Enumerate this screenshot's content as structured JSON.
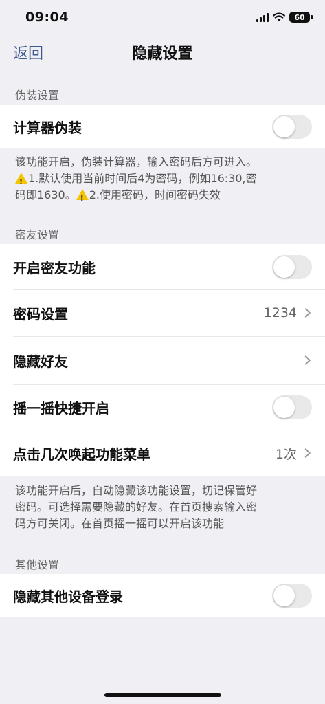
{
  "status_bar": {
    "time": "09:04",
    "battery": "60"
  },
  "nav": {
    "back_label": "返回",
    "title": "隐藏设置"
  },
  "sections": {
    "disguise": {
      "header": "伪装设置",
      "calculator_label": "计算器伪装",
      "calculator_toggle": false,
      "note_line1": "该功能开启，伪装计算器，输入密码后方可进入。",
      "note_part1": "1.默认使用当前时间后4为密码，例如16:30,密",
      "note_part2": "码即1630。",
      "note_part3": "2.使用密码，时间密码失效"
    },
    "secret_friend": {
      "header": "密友设置",
      "rows": [
        {
          "label": "开启密友功能",
          "toggle": false
        },
        {
          "label": "密码设置",
          "value": "1234"
        },
        {
          "label": "隐藏好友"
        },
        {
          "label": "摇一摇快捷开启",
          "toggle": false
        },
        {
          "label": "点击几次唤起功能菜单",
          "value": "1次"
        }
      ],
      "note_line1": "该功能开启后，自动隐藏该功能设置，切记保管好",
      "note_line2": "密码。可选择需要隐藏的好友。在首页搜索输入密",
      "note_line3": "码方可关闭。在首页摇一摇可以开启该功能"
    },
    "other": {
      "header": "其他设置",
      "hide_login_label": "隐藏其他设备登录",
      "hide_login_toggle": false
    }
  },
  "colors": {
    "accent": "#3d5a8f",
    "background": "#efeff4",
    "toggle_off": "#e9e9ea",
    "warning": "#f5c400"
  },
  "icons": {
    "warning": "warning-icon",
    "chevron": "chevron-right-icon",
    "wifi": "wifi-icon",
    "signal": "signal-icon",
    "battery": "battery-icon"
  }
}
